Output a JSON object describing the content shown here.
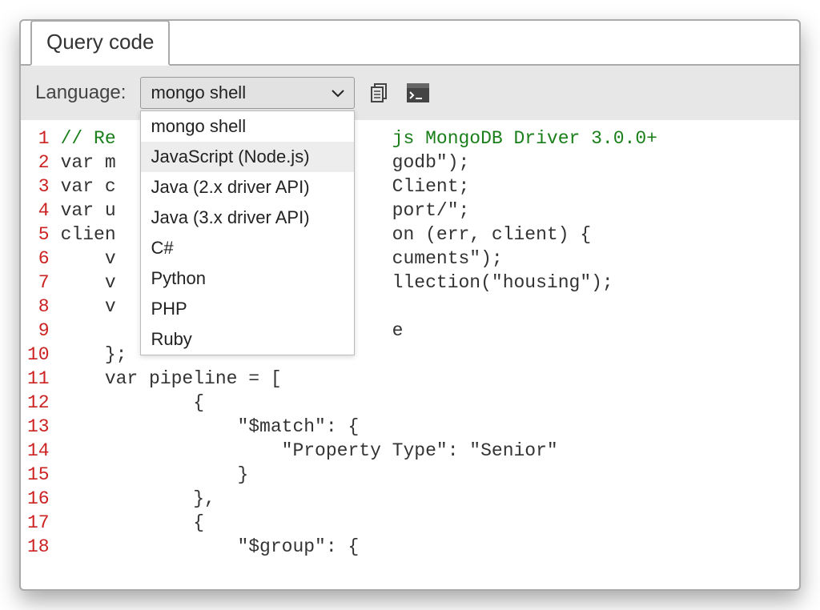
{
  "tab": {
    "label": "Query code"
  },
  "toolbar": {
    "language_label": "Language:",
    "selected": "mongo shell",
    "options": [
      "mongo shell",
      "JavaScript (Node.js)",
      "Java (2.x driver API)",
      "Java (3.x driver API)",
      "C#",
      "Python",
      "PHP",
      "Ruby"
    ],
    "hovered_index": 1
  },
  "code": {
    "lines": [
      {
        "n": 1,
        "type": "comment",
        "text": "// Re                         js MongoDB Driver 3.0.0+"
      },
      {
        "n": 2,
        "type": "plain",
        "text": "var m                         godb\");"
      },
      {
        "n": 3,
        "type": "plain",
        "text": "var c                         Client;"
      },
      {
        "n": 4,
        "type": "plain",
        "text": "var u                         port/\";"
      },
      {
        "n": 5,
        "type": "plain",
        "text": "clien                         on (err, client) {"
      },
      {
        "n": 6,
        "type": "plain",
        "text": "    v                         cuments\");"
      },
      {
        "n": 7,
        "type": "plain",
        "text": "    v                         llection(\"housing\");"
      },
      {
        "n": 8,
        "type": "plain",
        "text": "    v"
      },
      {
        "n": 9,
        "type": "plain",
        "text": "                              e"
      },
      {
        "n": 10,
        "type": "plain",
        "text": "    };"
      },
      {
        "n": 11,
        "type": "plain",
        "text": "    var pipeline = ["
      },
      {
        "n": 12,
        "type": "plain",
        "text": "            {"
      },
      {
        "n": 13,
        "type": "plain",
        "text": "                \"$match\": {"
      },
      {
        "n": 14,
        "type": "plain",
        "text": "                    \"Property Type\": \"Senior\""
      },
      {
        "n": 15,
        "type": "plain",
        "text": "                }"
      },
      {
        "n": 16,
        "type": "plain",
        "text": "            },"
      },
      {
        "n": 17,
        "type": "plain",
        "text": "            {"
      },
      {
        "n": 18,
        "type": "plain",
        "text": "                \"$group\": {"
      }
    ]
  }
}
